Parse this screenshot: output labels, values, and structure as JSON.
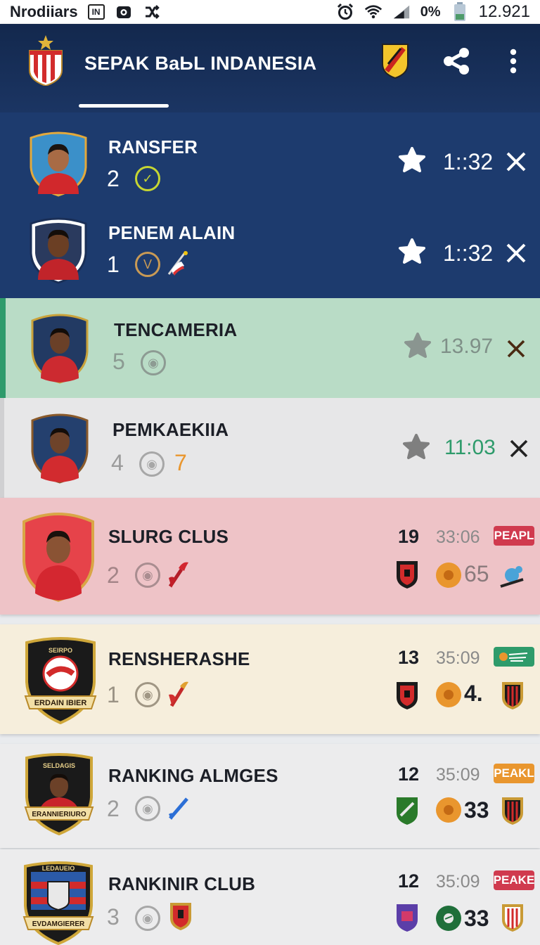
{
  "status_bar": {
    "carrier": "Nrodiiars",
    "box_label": "IN",
    "battery_pct": "0%",
    "time": "12.921",
    "icons": [
      "camera-icon",
      "shuffle-icon",
      "alarm-icon",
      "wifi-icon",
      "signal-icon",
      "battery-icon"
    ]
  },
  "app_bar": {
    "title": "SEPAK BаЬL INDANESIA",
    "actions": [
      "shield-badge-icon",
      "share-icon",
      "more-vertical-icon"
    ]
  },
  "rows": [
    {
      "name": "RANSFER",
      "number": "2",
      "time": "1::32",
      "theme": "blue"
    },
    {
      "name": "PENEM ALAIN",
      "number": "1",
      "time": "1::32",
      "theme": "blue"
    },
    {
      "name": "TENCAMERIA",
      "number": "5",
      "time": "13.97",
      "theme": "green"
    },
    {
      "name": "PEMKAEKIIA",
      "number": "4",
      "extra": "7",
      "time": "11:03",
      "theme": "grey"
    },
    {
      "name": "SLURG CLUS",
      "number": "2",
      "score": "19",
      "clock": "33:06",
      "tag": "PEAPL",
      "stat": "65",
      "theme": "pink"
    },
    {
      "name": "RENSHERASHE",
      "number": "1",
      "score": "13",
      "clock": "35:09",
      "stat": "4.",
      "theme": "cream"
    },
    {
      "name": "RANKING ALMGES",
      "number": "2",
      "score": "12",
      "clock": "35:09",
      "tag": "PEAKL",
      "stat": "33",
      "theme": "light"
    },
    {
      "name": "RANKINIR CLUB",
      "number": "3",
      "score": "12",
      "clock": "35:09",
      "tag": "PEAKE",
      "stat": "33",
      "theme": "light"
    }
  ],
  "crest_text": {
    "row6_top": "SEIRPO",
    "row6_ribbon": "ERDAIN IBIER",
    "row7_top": "SELDAGIS",
    "row7_ribbon": "ERANNIERIURO",
    "row8_top": "LEDAUEIO",
    "row8_ribbon": "EVDAMGIERER"
  },
  "colors": {
    "appbar": "#1b3563",
    "blue_row": "#1d3b6e",
    "green_row": "#b9dcc6",
    "grey_row": "#e7e7e8",
    "pink_row": "#eec3c7",
    "cream_row": "#f6eedc",
    "light_row": "#ececed",
    "accent_green": "#2e9b6b",
    "accent_red": "#d03a4e",
    "accent_orange": "#e9962e"
  }
}
